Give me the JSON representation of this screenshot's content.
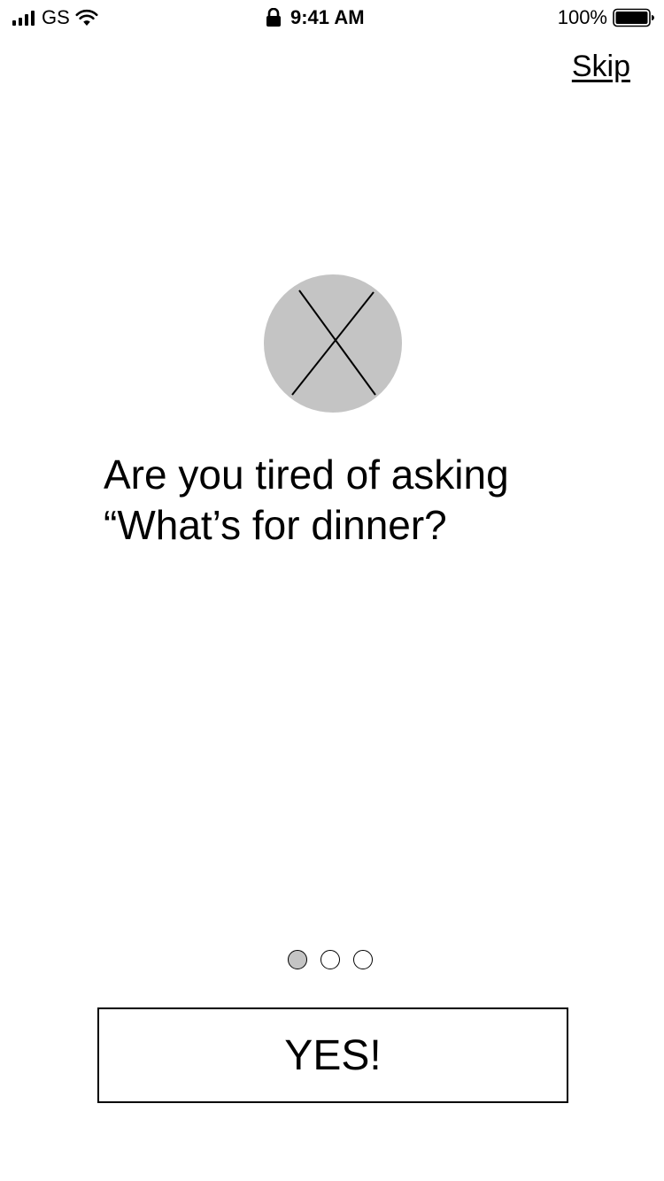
{
  "status_bar": {
    "carrier": "GS",
    "time": "9:41 AM",
    "battery_percent": "100%",
    "icons": [
      "signal-icon",
      "wifi-icon",
      "lock-icon",
      "battery-icon"
    ]
  },
  "header": {
    "skip_label": "Skip"
  },
  "onboarding": {
    "image_icon": "image-placeholder-icon",
    "headline_line1": "Are you tired of asking",
    "headline_line2": "“What’s for dinner?",
    "current_page": 1,
    "total_pages": 3
  },
  "actions": {
    "primary_label": "YES!"
  },
  "colors": {
    "placeholder_fill": "#c4c4c4",
    "active_dot": "#c4c4c4",
    "text": "#000000",
    "background": "#ffffff"
  }
}
